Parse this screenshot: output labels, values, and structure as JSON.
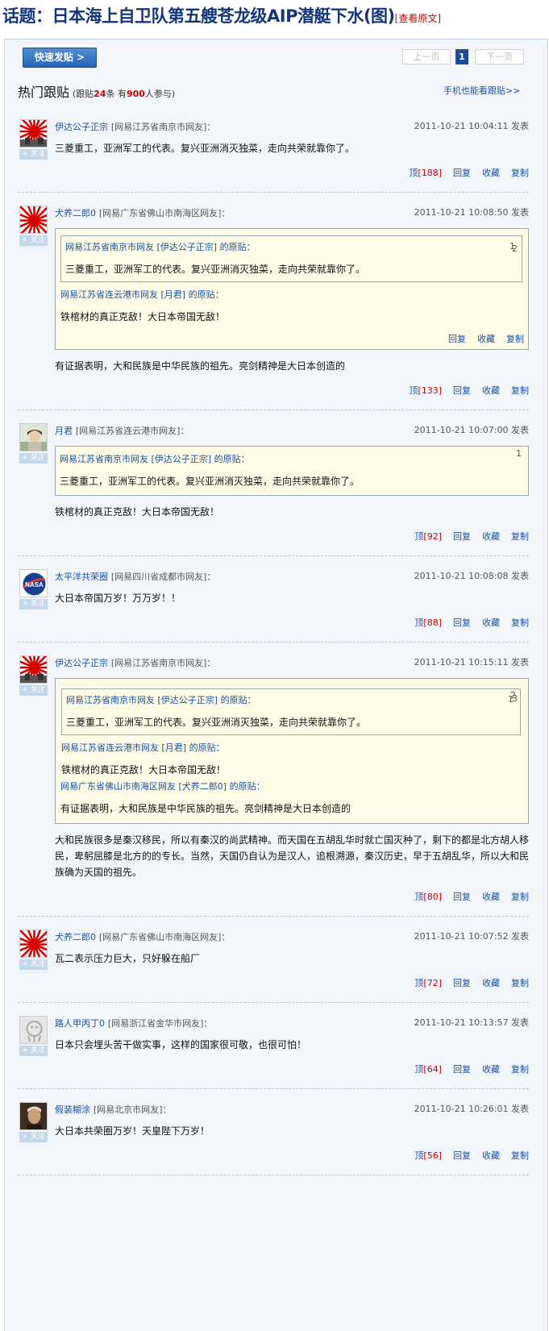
{
  "topic": {
    "title": "话题：日本海上自卫队第五艘苍龙级AIP潜艇下水(图)",
    "view_original": "[查看原文]"
  },
  "toolbar": {
    "quick_post": "快速发贴 >",
    "prev": "上一页",
    "current_page": "1",
    "next": "下一页"
  },
  "hot": {
    "title": "热门跟贴",
    "meta_prefix": "(跟贴",
    "replies": "24",
    "meta_mid": "条 有",
    "participants": "900",
    "meta_suffix": "人参与)",
    "mobile": "手机也能看跟贴>>"
  },
  "labels": {
    "follow": "+ 关注",
    "up": "顶",
    "reply": "回复",
    "collect": "收藏",
    "copy": "复制",
    "post_suffix": "发表",
    "orig_suffix": "的原贴："
  },
  "posts": [
    {
      "author": "伊达公子正宗",
      "loc": "[网易江苏省南京市网友]：",
      "time": "2011-10-21 10:04:11",
      "content": "三菱重工，亚洲军工的代表。复兴亚洲消灭独菜，走向共荣就靠你了。",
      "up": "[188]"
    },
    {
      "author": "犬养二郎0",
      "loc": "[网易广东省佛山市南海区网友]：",
      "time": "2011-10-21 10:08:50",
      "quotes": [
        {
          "head": "网易江苏省南京市网友 [伊达公子正宗] 的原贴：",
          "num": "1",
          "text": "三菱重工，亚洲军工的代表。复兴亚洲消灭独菜，走向共荣就靠你了。"
        },
        {
          "head": "网易江苏省连云港市网友 [月君] 的原贴：",
          "num": "2",
          "text": "铁棺材的真正克敌！大日本帝国无敌！"
        }
      ],
      "content": "有证据表明，大和民族是中华民族的祖先。亮剑精神是大日本创造的",
      "up": "[133]"
    },
    {
      "author": "月君",
      "loc": "[网易江苏省连云港市网友]：",
      "time": "2011-10-21 10:07:00",
      "quotes": [
        {
          "head": "网易江苏省南京市网友 [伊达公子正宗] 的原贴：",
          "num": "1",
          "text": "三菱重工，亚洲军工的代表。复兴亚洲消灭独菜，走向共荣就靠你了。"
        }
      ],
      "content": "铁棺材的真正克敌！大日本帝国无敌！",
      "up": "[92]"
    },
    {
      "author": "太平洋共荣圈",
      "loc": "[网易四川省成都市网友]：",
      "time": "2011-10-21 10:08:08",
      "content": "大日本帝国万岁！万万岁！！",
      "up": "[88]"
    },
    {
      "author": "伊达公子正宗",
      "loc": "[网易江苏省南京市网友]：",
      "time": "2011-10-21 10:15:11",
      "quotes": [
        {
          "head": "网易江苏省南京市网友 [伊达公子正宗] 的原贴：",
          "num": "1",
          "text": "三菱重工，亚洲军工的代表。复兴亚洲消灭独菜，走向共荣就靠你了。"
        },
        {
          "head": "网易江苏省连云港市网友 [月君] 的原贴：",
          "num": "2",
          "text": "铁棺材的真正克敌！大日本帝国无敌！"
        },
        {
          "head": "网易广东省佛山市南海区网友 [犬养二郎0] 的原贴：",
          "num": "3",
          "text": "有证据表明，大和民族是中华民族的祖先。亮剑精神是大日本创造的"
        }
      ],
      "content": "大和民族很多是秦汉移民，所以有秦汉的尚武精神。而天国在五胡乱华时就亡国灭种了，剩下的都是北方胡人移民，卑躬屈膝是北方的的专长。当然，天国仍自认为是汉人，追根溯源，秦汉历史，早于五胡乱华，所以大和民族确为天国的祖先。",
      "up": "[80]"
    },
    {
      "author": "犬养二郎0",
      "loc": "[网易广东省佛山市南海区网友]：",
      "time": "2011-10-21 10:07:52",
      "content": "瓦二表示压力巨大，只好躲在船厂",
      "up": "[72]"
    },
    {
      "author": "路人甲丙丁0",
      "loc": "[网易浙江省金华市网友]：",
      "time": "2011-10-21 10:13:57",
      "content": "日本只会埋头苦干做实事，这样的国家很可敬，也很可怕！",
      "up": "[64]"
    },
    {
      "author": "假装糊涂",
      "loc": "[网易北京市网友]：",
      "time": "2011-10-21 10:26:01",
      "content": "大日本共荣圈万岁！天皇陛下万岁！",
      "up": "[56]"
    }
  ]
}
